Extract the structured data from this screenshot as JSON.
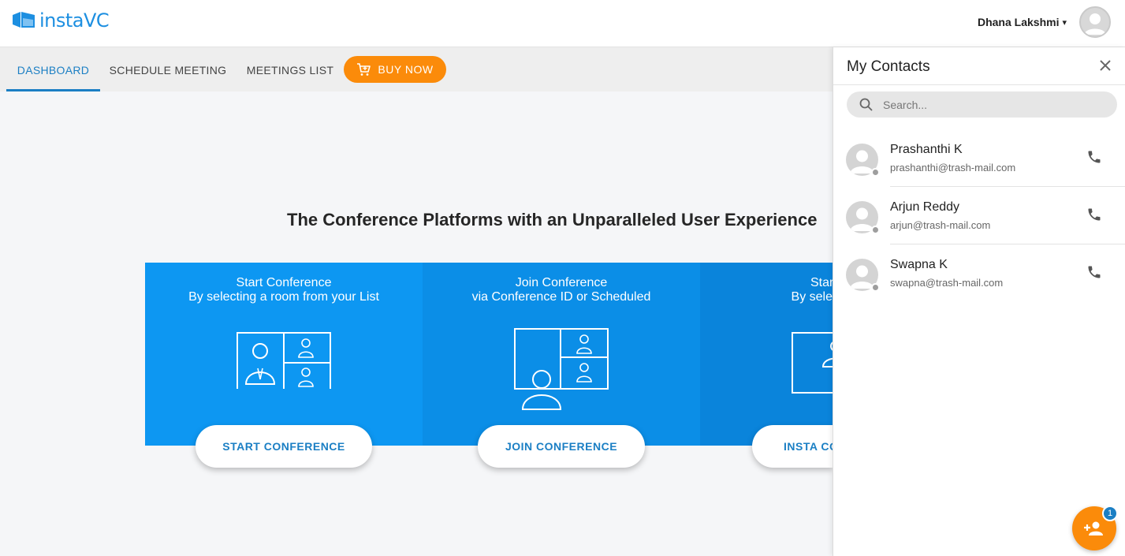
{
  "app": {
    "logo_text": "instaVC"
  },
  "header": {
    "user_name": "Dhana Lakshmi",
    "caret": "▾",
    "avatar_icon": "user-avatar-icon"
  },
  "nav": {
    "tabs": [
      {
        "label": "DASHBOARD",
        "active": true
      },
      {
        "label": "SCHEDULE MEETING",
        "active": false
      },
      {
        "label": "MEETINGS LIST",
        "active": false
      }
    ],
    "buy_now": "BUY NOW",
    "buy_icon": "cart-icon"
  },
  "main": {
    "title": "The Conference Platforms with an Unparalleled User Experience",
    "cards": [
      {
        "line1": "Start Conference",
        "line2": "By selecting a room from your List",
        "button": "START CONFERENCE",
        "color": "#0d97f2"
      },
      {
        "line1": "Join Conference",
        "line2": "via Conference ID or Scheduled",
        "button": "JOIN CONFERENCE",
        "color": "#0b8ee7"
      },
      {
        "line1": "Start Conf",
        "line2": "By selecting a co",
        "button": "INSTA CO",
        "color": "#0a84db"
      }
    ]
  },
  "contacts_panel": {
    "title": "My Contacts",
    "search_placeholder": "Search...",
    "contacts": [
      {
        "name": "Prashanthi K",
        "email": "prashanthi@trash-mail.com"
      },
      {
        "name": "Arjun Reddy",
        "email": "arjun@trash-mail.com"
      },
      {
        "name": "Swapna K",
        "email": "swapna@trash-mail.com"
      }
    ],
    "fab_badge": "1"
  },
  "colors": {
    "accent_blue": "#1b7fc4",
    "orange": "#fb8b0a"
  }
}
